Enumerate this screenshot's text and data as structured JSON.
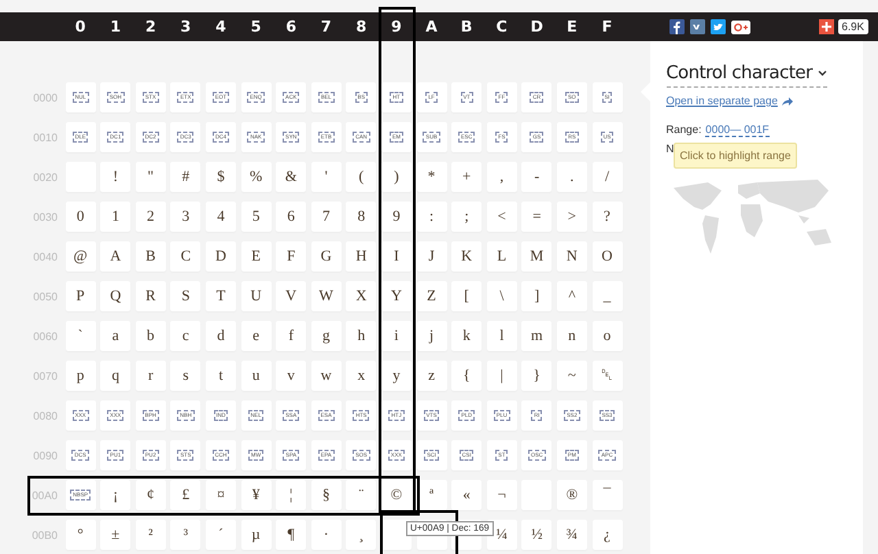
{
  "columns": [
    {
      "label": "0",
      "highlighted": false
    },
    {
      "label": "1",
      "highlighted": false
    },
    {
      "label": "2",
      "highlighted": false
    },
    {
      "label": "3",
      "highlighted": false
    },
    {
      "label": "4",
      "highlighted": false
    },
    {
      "label": "5",
      "highlighted": false
    },
    {
      "label": "6",
      "highlighted": false
    },
    {
      "label": "7",
      "highlighted": false
    },
    {
      "label": "8",
      "highlighted": false
    },
    {
      "label": "9",
      "highlighted": true
    },
    {
      "label": "A",
      "highlighted": false
    },
    {
      "label": "B",
      "highlighted": false
    },
    {
      "label": "C",
      "highlighted": false
    },
    {
      "label": "D",
      "highlighted": false
    },
    {
      "label": "E",
      "highlighted": false
    },
    {
      "label": "F",
      "highlighted": false
    }
  ],
  "share": {
    "count": "6.9K"
  },
  "rows": [
    {
      "label": "0000",
      "highlighted": false,
      "cells": [
        {
          "kind": "control",
          "text": "NUL"
        },
        {
          "kind": "control",
          "text": "SOH"
        },
        {
          "kind": "control",
          "text": "STX"
        },
        {
          "kind": "control",
          "text": "ETX"
        },
        {
          "kind": "control",
          "text": "EOT"
        },
        {
          "kind": "control",
          "text": "ENQ"
        },
        {
          "kind": "control",
          "text": "ACK"
        },
        {
          "kind": "control",
          "text": "BEL"
        },
        {
          "kind": "control",
          "text": "BS"
        },
        {
          "kind": "control",
          "text": "HT"
        },
        {
          "kind": "control",
          "text": "LF"
        },
        {
          "kind": "control",
          "text": "VT"
        },
        {
          "kind": "control",
          "text": "FF"
        },
        {
          "kind": "control",
          "text": "CR"
        },
        {
          "kind": "control",
          "text": "SO"
        },
        {
          "kind": "control",
          "text": "SI"
        }
      ]
    },
    {
      "label": "0010",
      "highlighted": false,
      "cells": [
        {
          "kind": "control",
          "text": "DLE"
        },
        {
          "kind": "control",
          "text": "DC1"
        },
        {
          "kind": "control",
          "text": "DC2"
        },
        {
          "kind": "control",
          "text": "DC3"
        },
        {
          "kind": "control",
          "text": "DC4"
        },
        {
          "kind": "control",
          "text": "NAK"
        },
        {
          "kind": "control",
          "text": "SYN"
        },
        {
          "kind": "control",
          "text": "ETB"
        },
        {
          "kind": "control",
          "text": "CAN"
        },
        {
          "kind": "control",
          "text": "EM"
        },
        {
          "kind": "control",
          "text": "SUB"
        },
        {
          "kind": "control",
          "text": "ESC"
        },
        {
          "kind": "control",
          "text": "FS"
        },
        {
          "kind": "control",
          "text": "GS"
        },
        {
          "kind": "control",
          "text": "RS"
        },
        {
          "kind": "control",
          "text": "US"
        }
      ]
    },
    {
      "label": "0020",
      "highlighted": false,
      "cells": [
        {
          "kind": "blank"
        },
        {
          "kind": "char",
          "text": "!"
        },
        {
          "kind": "char",
          "text": "\""
        },
        {
          "kind": "char",
          "text": "#"
        },
        {
          "kind": "char",
          "text": "$"
        },
        {
          "kind": "char",
          "text": "%"
        },
        {
          "kind": "char",
          "text": "&"
        },
        {
          "kind": "char",
          "text": "'"
        },
        {
          "kind": "char",
          "text": "("
        },
        {
          "kind": "char",
          "text": ")"
        },
        {
          "kind": "char",
          "text": "*"
        },
        {
          "kind": "char",
          "text": "+"
        },
        {
          "kind": "char",
          "text": ","
        },
        {
          "kind": "char",
          "text": "-"
        },
        {
          "kind": "char",
          "text": "."
        },
        {
          "kind": "char",
          "text": "/"
        }
      ]
    },
    {
      "label": "0030",
      "highlighted": false,
      "cells": [
        {
          "kind": "char",
          "text": "0"
        },
        {
          "kind": "char",
          "text": "1"
        },
        {
          "kind": "char",
          "text": "2"
        },
        {
          "kind": "char",
          "text": "3"
        },
        {
          "kind": "char",
          "text": "4"
        },
        {
          "kind": "char",
          "text": "5"
        },
        {
          "kind": "char",
          "text": "6"
        },
        {
          "kind": "char",
          "text": "7"
        },
        {
          "kind": "char",
          "text": "8"
        },
        {
          "kind": "char",
          "text": "9"
        },
        {
          "kind": "char",
          "text": ":"
        },
        {
          "kind": "char",
          "text": ";"
        },
        {
          "kind": "char",
          "text": "<"
        },
        {
          "kind": "char",
          "text": "="
        },
        {
          "kind": "char",
          "text": ">"
        },
        {
          "kind": "char",
          "text": "?"
        }
      ]
    },
    {
      "label": "0040",
      "highlighted": false,
      "cells": [
        {
          "kind": "char",
          "text": "@"
        },
        {
          "kind": "char",
          "text": "A"
        },
        {
          "kind": "char",
          "text": "B"
        },
        {
          "kind": "char",
          "text": "C"
        },
        {
          "kind": "char",
          "text": "D"
        },
        {
          "kind": "char",
          "text": "E"
        },
        {
          "kind": "char",
          "text": "F"
        },
        {
          "kind": "char",
          "text": "G"
        },
        {
          "kind": "char",
          "text": "H"
        },
        {
          "kind": "char",
          "text": "I"
        },
        {
          "kind": "char",
          "text": "J"
        },
        {
          "kind": "char",
          "text": "K"
        },
        {
          "kind": "char",
          "text": "L"
        },
        {
          "kind": "char",
          "text": "M"
        },
        {
          "kind": "char",
          "text": "N"
        },
        {
          "kind": "char",
          "text": "O"
        }
      ]
    },
    {
      "label": "0050",
      "highlighted": false,
      "cells": [
        {
          "kind": "char",
          "text": "P"
        },
        {
          "kind": "char",
          "text": "Q"
        },
        {
          "kind": "char",
          "text": "R"
        },
        {
          "kind": "char",
          "text": "S"
        },
        {
          "kind": "char",
          "text": "T"
        },
        {
          "kind": "char",
          "text": "U"
        },
        {
          "kind": "char",
          "text": "V"
        },
        {
          "kind": "char",
          "text": "W"
        },
        {
          "kind": "char",
          "text": "X"
        },
        {
          "kind": "char",
          "text": "Y"
        },
        {
          "kind": "char",
          "text": "Z"
        },
        {
          "kind": "char",
          "text": "["
        },
        {
          "kind": "char",
          "text": "\\"
        },
        {
          "kind": "char",
          "text": "]"
        },
        {
          "kind": "char",
          "text": "^"
        },
        {
          "kind": "char",
          "text": "_"
        }
      ]
    },
    {
      "label": "0060",
      "highlighted": false,
      "cells": [
        {
          "kind": "char",
          "text": "`"
        },
        {
          "kind": "char",
          "text": "a"
        },
        {
          "kind": "char",
          "text": "b"
        },
        {
          "kind": "char",
          "text": "c"
        },
        {
          "kind": "char",
          "text": "d"
        },
        {
          "kind": "char",
          "text": "e"
        },
        {
          "kind": "char",
          "text": "f"
        },
        {
          "kind": "char",
          "text": "g"
        },
        {
          "kind": "char",
          "text": "h"
        },
        {
          "kind": "char",
          "text": "i"
        },
        {
          "kind": "char",
          "text": "j"
        },
        {
          "kind": "char",
          "text": "k"
        },
        {
          "kind": "char",
          "text": "l"
        },
        {
          "kind": "char",
          "text": "m"
        },
        {
          "kind": "char",
          "text": "n"
        },
        {
          "kind": "char",
          "text": "o"
        }
      ]
    },
    {
      "label": "0070",
      "highlighted": false,
      "cells": [
        {
          "kind": "char",
          "text": "p"
        },
        {
          "kind": "char",
          "text": "q"
        },
        {
          "kind": "char",
          "text": "r"
        },
        {
          "kind": "char",
          "text": "s"
        },
        {
          "kind": "char",
          "text": "t"
        },
        {
          "kind": "char",
          "text": "u"
        },
        {
          "kind": "char",
          "text": "v"
        },
        {
          "kind": "char",
          "text": "w"
        },
        {
          "kind": "char",
          "text": "x"
        },
        {
          "kind": "char",
          "text": "y"
        },
        {
          "kind": "char",
          "text": "z"
        },
        {
          "kind": "char",
          "text": "{"
        },
        {
          "kind": "char",
          "text": "|"
        },
        {
          "kind": "char",
          "text": "}"
        },
        {
          "kind": "char",
          "text": "~"
        },
        {
          "kind": "char",
          "text": "␡"
        }
      ]
    },
    {
      "label": "0080",
      "highlighted": false,
      "cells": [
        {
          "kind": "control",
          "text": "XXX"
        },
        {
          "kind": "control",
          "text": "XXX"
        },
        {
          "kind": "control",
          "text": "BPH"
        },
        {
          "kind": "control",
          "text": "NBH"
        },
        {
          "kind": "control",
          "text": "IND"
        },
        {
          "kind": "control",
          "text": "NEL"
        },
        {
          "kind": "control",
          "text": "SSA"
        },
        {
          "kind": "control",
          "text": "ESA"
        },
        {
          "kind": "control",
          "text": "HTS"
        },
        {
          "kind": "control",
          "text": "HTJ"
        },
        {
          "kind": "control",
          "text": "VTS"
        },
        {
          "kind": "control",
          "text": "PLD"
        },
        {
          "kind": "control",
          "text": "PLU"
        },
        {
          "kind": "control",
          "text": "RI"
        },
        {
          "kind": "control",
          "text": "SS2"
        },
        {
          "kind": "control",
          "text": "SS3"
        }
      ]
    },
    {
      "label": "0090",
      "highlighted": false,
      "cells": [
        {
          "kind": "control",
          "text": "DCS"
        },
        {
          "kind": "control",
          "text": "PU1"
        },
        {
          "kind": "control",
          "text": "PU2"
        },
        {
          "kind": "control",
          "text": "STS"
        },
        {
          "kind": "control",
          "text": "CCH"
        },
        {
          "kind": "control",
          "text": "MW"
        },
        {
          "kind": "control",
          "text": "SPA"
        },
        {
          "kind": "control",
          "text": "EPA"
        },
        {
          "kind": "control",
          "text": "SOS"
        },
        {
          "kind": "control",
          "text": "XXX"
        },
        {
          "kind": "control",
          "text": "SCI"
        },
        {
          "kind": "control",
          "text": "CSI"
        },
        {
          "kind": "control",
          "text": "ST"
        },
        {
          "kind": "control",
          "text": "OSC"
        },
        {
          "kind": "control",
          "text": "PM"
        },
        {
          "kind": "control",
          "text": "APC"
        }
      ]
    },
    {
      "label": "00A0",
      "highlighted": true,
      "cells": [
        {
          "kind": "control",
          "text": "NBSP"
        },
        {
          "kind": "char",
          "text": "¡"
        },
        {
          "kind": "char",
          "text": "¢"
        },
        {
          "kind": "char",
          "text": "£"
        },
        {
          "kind": "char",
          "text": "¤"
        },
        {
          "kind": "char",
          "text": "¥"
        },
        {
          "kind": "char",
          "text": "¦"
        },
        {
          "kind": "char",
          "text": "§"
        },
        {
          "kind": "char",
          "text": "¨"
        },
        {
          "kind": "char",
          "text": "©"
        },
        {
          "kind": "char",
          "text": "ª"
        },
        {
          "kind": "char",
          "text": "«"
        },
        {
          "kind": "char",
          "text": "¬"
        },
        {
          "kind": "blank"
        },
        {
          "kind": "char",
          "text": "®"
        },
        {
          "kind": "char",
          "text": "¯"
        }
      ]
    },
    {
      "label": "00B0",
      "highlighted": false,
      "cells": [
        {
          "kind": "char",
          "text": "°"
        },
        {
          "kind": "char",
          "text": "±"
        },
        {
          "kind": "char",
          "text": "²"
        },
        {
          "kind": "char",
          "text": "³"
        },
        {
          "kind": "char",
          "text": "´"
        },
        {
          "kind": "char",
          "text": "µ"
        },
        {
          "kind": "char",
          "text": "¶"
        },
        {
          "kind": "char",
          "text": "·"
        },
        {
          "kind": "char",
          "text": "¸"
        },
        {
          "kind": "blank"
        },
        {
          "kind": "blank"
        },
        {
          "kind": "blank"
        },
        {
          "kind": "char",
          "text": "¼"
        },
        {
          "kind": "char",
          "text": "½"
        },
        {
          "kind": "char",
          "text": "¾"
        },
        {
          "kind": "char",
          "text": "¿"
        }
      ]
    }
  ],
  "cell_tooltip": {
    "text": "U+00A9 | Dec: 169",
    "framed": true
  },
  "panel": {
    "title": "Control character",
    "link": "Open in separate page",
    "range_label": "Range:",
    "range_value": "0000— 001F",
    "note": "N",
    "tooltip": "Click to highlight range"
  }
}
